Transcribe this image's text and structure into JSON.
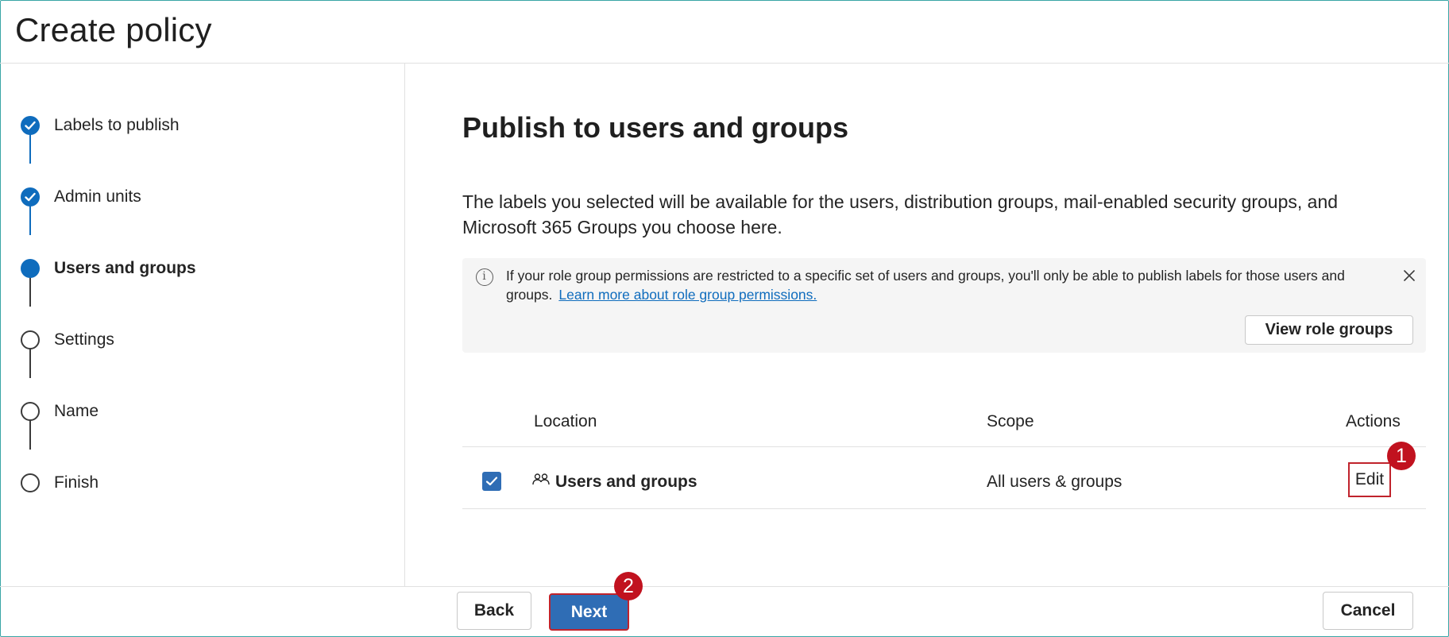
{
  "header": {
    "title": "Create policy"
  },
  "steps": [
    {
      "label": "Labels to publish",
      "state": "done"
    },
    {
      "label": "Admin units",
      "state": "done"
    },
    {
      "label": "Users and groups",
      "state": "current"
    },
    {
      "label": "Settings",
      "state": "todo"
    },
    {
      "label": "Name",
      "state": "todo"
    },
    {
      "label": "Finish",
      "state": "todo"
    }
  ],
  "main": {
    "title": "Publish to users and groups",
    "description": "The labels you selected will be available for the users, distribution groups, mail-enabled security groups, and Microsoft 365 Groups you choose here.",
    "info": {
      "text": "If your role group permissions are restricted to a specific set of users and groups, you'll only be able to publish labels for those users and groups.",
      "link": "Learn more about role group permissions.",
      "button": "View role groups"
    },
    "table": {
      "headers": {
        "location": "Location",
        "scope": "Scope",
        "actions": "Actions"
      },
      "rows": [
        {
          "checked": true,
          "location": "Users and groups",
          "scope": "All users & groups",
          "action": "Edit"
        }
      ]
    }
  },
  "callouts": {
    "one": "1",
    "two": "2"
  },
  "footer": {
    "back": "Back",
    "next": "Next",
    "cancel": "Cancel"
  },
  "colors": {
    "accent": "#0f6cbd",
    "button_primary": "#2f6db5",
    "callout": "#c1121f",
    "highlight_border": "#c0232c"
  }
}
